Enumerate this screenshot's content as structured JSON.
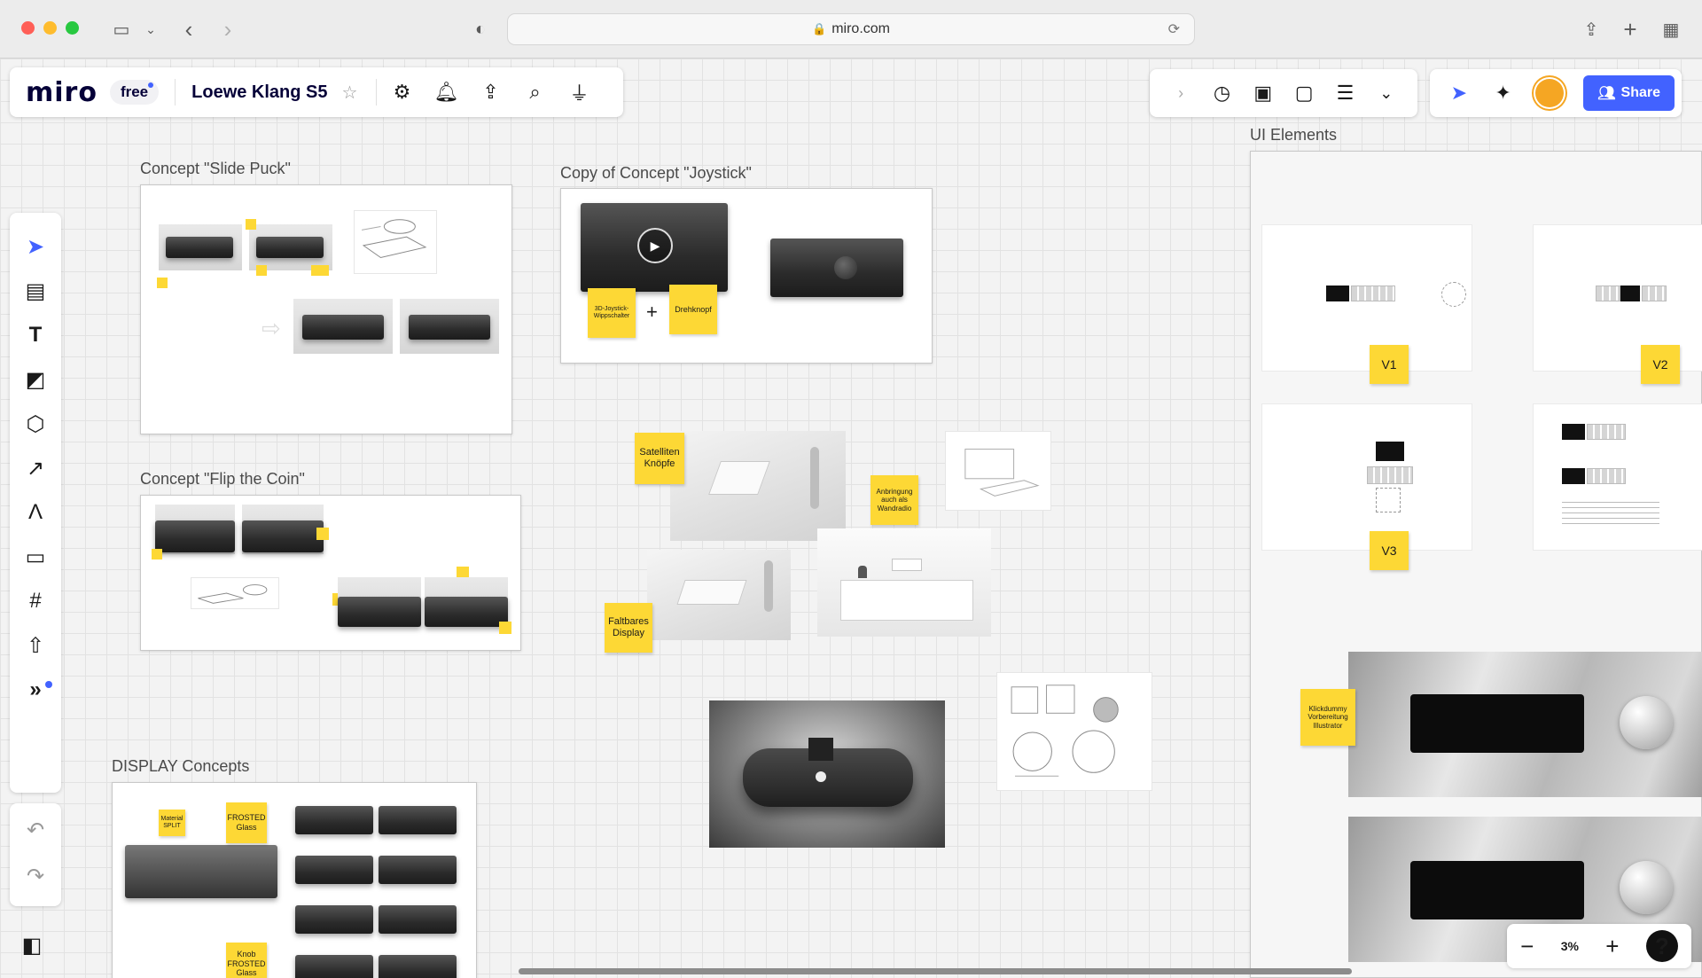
{
  "browser": {
    "url": "miro.com"
  },
  "app": {
    "logo": "miro",
    "plan": "free",
    "board_title": "Loewe Klang S5",
    "share_label": "Share"
  },
  "frames": {
    "slide_puck": "Concept \"Slide Puck\"",
    "joystick": "Copy of Concept \"Joystick\"",
    "flip_coin": "Concept \"Flip the Coin\"",
    "display": "DISPLAY Concepts",
    "ui_elements": "UI Elements"
  },
  "stickies": {
    "joystick_a": "3D-Joystick-Wippschalter",
    "joystick_b": "Drehknopf",
    "plus": "+",
    "satelliten": "Satelliten Knöpfe",
    "anbringung": "Anbringung auch als Wandradio",
    "faltbares": "Faltbares Display",
    "material": "Material SPLIT",
    "frosted": "FROSTED Glass",
    "knob_frosted": "Knob FROSTED Glass",
    "klickdummy": "Klickdummy Vorbereitung Illustrator",
    "v1": "V1",
    "v2": "V2",
    "v3": "V3"
  },
  "zoom": {
    "minus": "−",
    "level": "3%",
    "plus": "+",
    "help": "?"
  },
  "colors": {
    "accent": "#4262ff",
    "sticky": "#fdd835",
    "presence": "#f5a623"
  }
}
